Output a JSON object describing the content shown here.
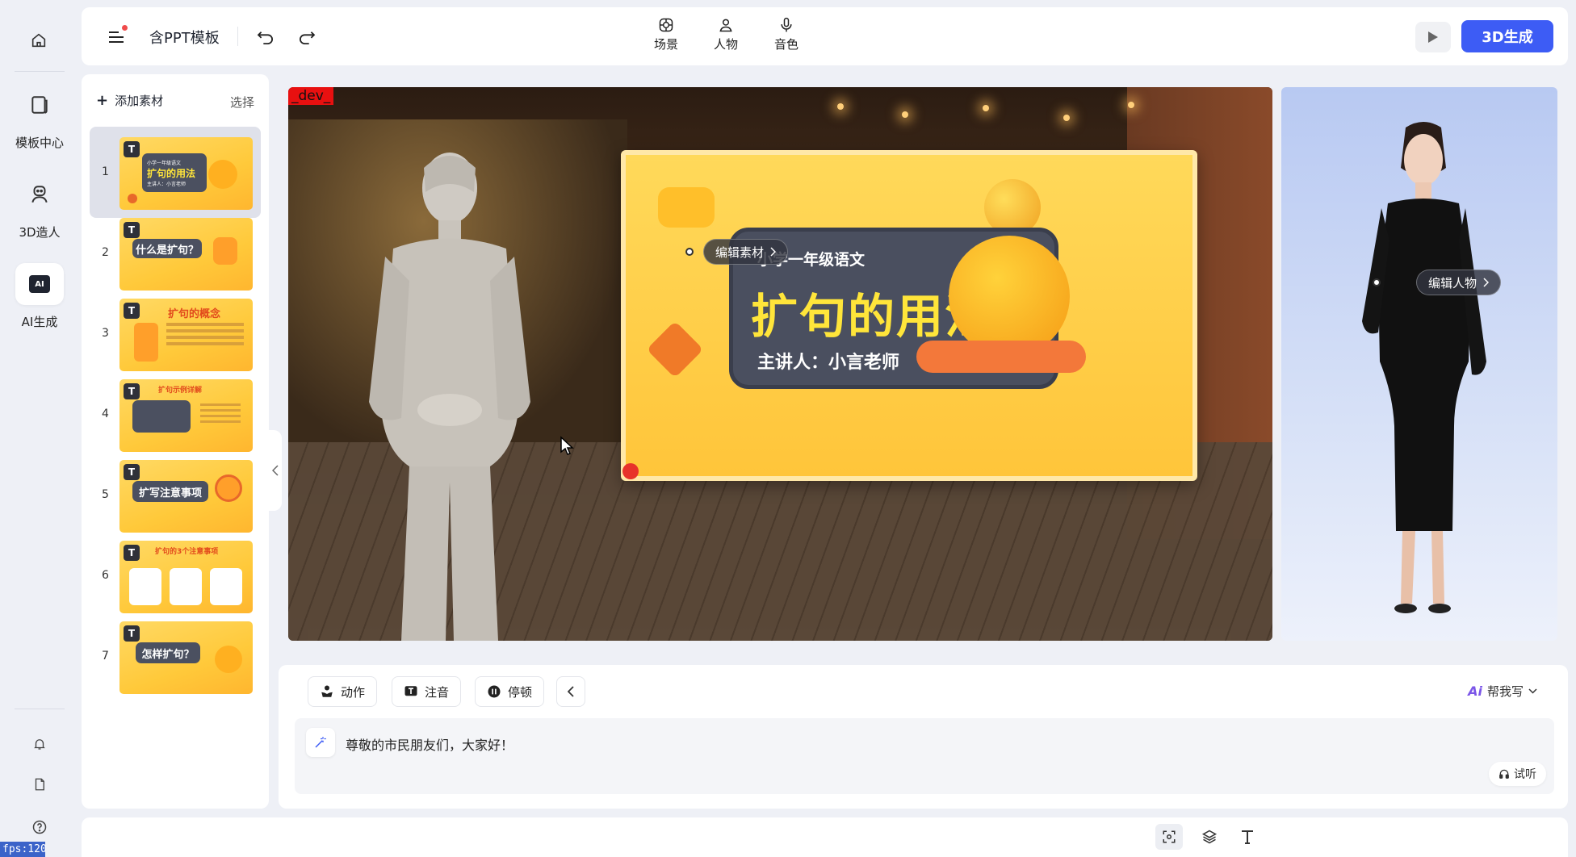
{
  "rail": {
    "items": [
      {
        "label": "模板中心",
        "icon": "template-icon"
      },
      {
        "label": "3D造人",
        "icon": "avatar-builder-icon"
      },
      {
        "label": "AI生成",
        "icon": "ai-icon"
      }
    ],
    "ai_badge": "AI",
    "fps": "fps:120"
  },
  "topbar": {
    "title": "含PPT模板",
    "tools": [
      {
        "label": "场景",
        "icon": "scene-icon"
      },
      {
        "label": "人物",
        "icon": "person-icon"
      },
      {
        "label": "音色",
        "icon": "microphone-icon"
      }
    ],
    "generate_label": "3D生成",
    "accent": "#3d5cf5"
  },
  "slides": {
    "add_label": "添加素材",
    "select_label": "选择",
    "type_badge": "T",
    "items": [
      {
        "num": "1",
        "text": "扩句的用法",
        "sub": "小学一年级语文",
        "speaker": "主讲人：小言老师"
      },
      {
        "num": "2",
        "text": "什么是扩句？"
      },
      {
        "num": "3",
        "text": "扩句的概念"
      },
      {
        "num": "4",
        "text": "扩句示例详解"
      },
      {
        "num": "5",
        "text": "扩写注意事项"
      },
      {
        "num": "6",
        "text": "扩句的3个注意事项"
      },
      {
        "num": "7",
        "text": "怎样扩句？"
      }
    ]
  },
  "canvas": {
    "dev_tag": "_dev_",
    "board_subtitle": "小学一年级语文",
    "board_title": "扩句的用法",
    "board_speaker": "主讲人：小言老师",
    "edit_material": "编辑素材",
    "edit_person": "编辑人物"
  },
  "editor": {
    "buttons": [
      {
        "label": "动作",
        "icon": "gesture-icon"
      },
      {
        "label": "注音",
        "icon": "phonetic-icon"
      },
      {
        "label": "停顿",
        "icon": "pause-icon"
      }
    ],
    "ai_mark": "Ai",
    "ai_write": "帮我写",
    "text": "尊敬的市民朋友们，大家好！",
    "listen": "试听"
  }
}
